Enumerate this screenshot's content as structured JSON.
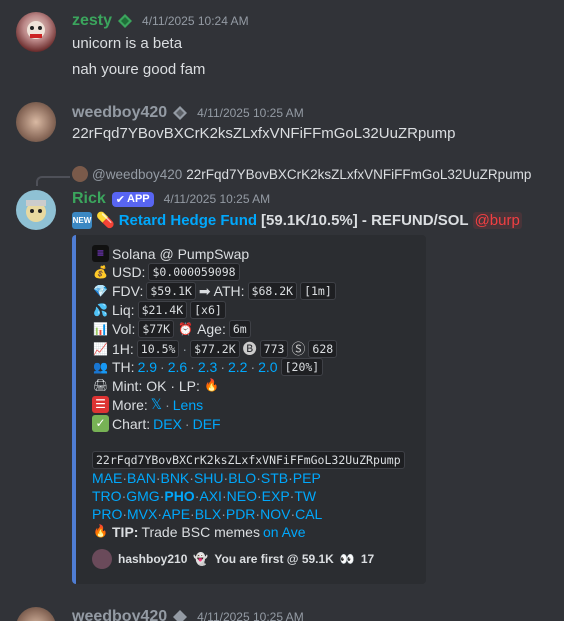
{
  "messages": [
    {
      "username": "zesty",
      "timestamp": "4/11/2025 10:24 AM",
      "lines": [
        "unicorn is a beta",
        "nah youre good fam"
      ],
      "name_color": "#3ba55d"
    },
    {
      "username": "weedboy420",
      "timestamp": "4/11/2025 10:25 AM",
      "lines": [
        "22rFqd7YBovBXCrK2ksZLxfxVNFiFFmGoL32UuZRpump"
      ],
      "name_color": "#949ba4"
    }
  ],
  "reply": {
    "mention": "@weedboy420",
    "text": "22rFqd7YBovBXCrK2ksZLxfxVNFiFFmGoL32UuZRpump"
  },
  "bot": {
    "username": "Rick",
    "app_tag": "APP",
    "timestamp": "4/11/2025 10:25 AM",
    "name_color": "#3ba55d",
    "title_link": "Retard Hedge Fund",
    "title_rest": "[59.1K/10.5%] - REFUND/SOL",
    "mention": "@burp"
  },
  "embed": {
    "chain": "Solana @ PumpSwap",
    "usd_label": "USD:",
    "usd": "$0.000059098",
    "fdv_label": "FDV:",
    "fdv": "$59.1K",
    "ath_label": "ATH:",
    "ath": "$68.2K",
    "ath_age": "[1m]",
    "liq_label": "Liq:",
    "liq": "$21.4K",
    "liq_mult": "[x6]",
    "vol_label": "Vol:",
    "vol": "$77K",
    "age_label": "Age:",
    "age": "6m",
    "h1_label": "1H:",
    "h1_pct": "10.5%",
    "h1_vol": "$77.2K",
    "buys": "773",
    "sells": "628",
    "th_label": "TH:",
    "th_values": [
      "2.9",
      "2.6",
      "2.3",
      "2.2",
      "2.0"
    ],
    "th_total": "[20%]",
    "mint": "Mint: OK · LP:",
    "more_label": "More:",
    "more_x": "𝕏",
    "more_lens": "Lens",
    "chart_label": "Chart:",
    "chart_dex": "DEX",
    "chart_def": "DEF",
    "address": "22rFqd7YBovBXCrK2ksZLxfxVNFiFFmGoL32UuZRpump",
    "links_row1": [
      "MAE",
      "BAN",
      "BNK",
      "SHU",
      "BLO",
      "STB",
      "PEP"
    ],
    "links_row2": [
      "TRO",
      "GMG",
      "PHO",
      "AXI",
      "NEO",
      "EXP",
      "TW"
    ],
    "links_row3": [
      "PRO",
      "MVX",
      "APE",
      "BLX",
      "PDR",
      "NOV",
      "CAL"
    ],
    "tip_label": "TIP:",
    "tip_text": "Trade BSC memes",
    "tip_link": "on Ave",
    "footer_user": "hashboy210",
    "footer_text": "You are first @ 59.1K",
    "footer_count": "17"
  },
  "bottom_peek": {
    "username": "weedboy420",
    "timestamp": "4/11/2025 10:25 AM"
  }
}
